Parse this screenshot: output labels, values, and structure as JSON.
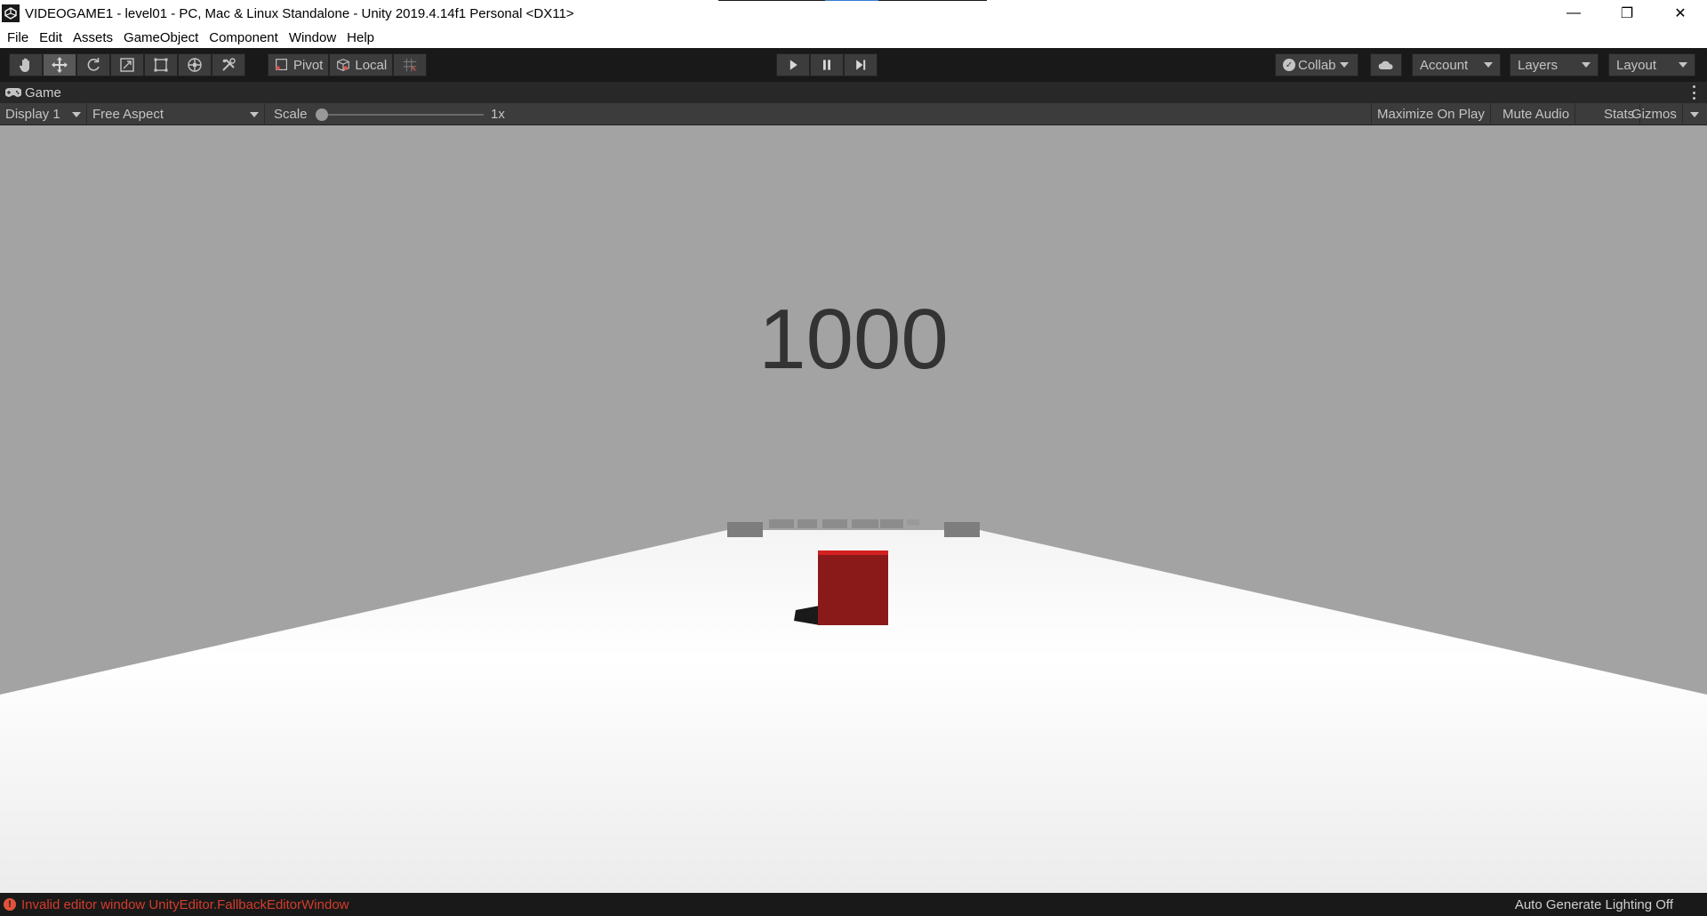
{
  "window": {
    "title": "VIDEOGAME1 - level01 - PC, Mac & Linux Standalone - Unity 2019.4.14f1 Personal <DX11>",
    "minimize_glyph": "—",
    "maximize_glyph": "❐",
    "close_glyph": "✕"
  },
  "menu": {
    "items": [
      "File",
      "Edit",
      "Assets",
      "GameObject",
      "Component",
      "Window",
      "Help"
    ]
  },
  "toolbar": {
    "tools": [
      "hand-tool-icon",
      "move-tool-icon",
      "rotate-tool-icon",
      "scale-tool-icon",
      "rect-tool-icon",
      "transform-tool-icon",
      "custom-tool-icon"
    ],
    "active_tool": "move-tool-icon",
    "pivot_label": "Pivot",
    "local_label": "Local",
    "collab_label": "Collab",
    "account_label": "Account",
    "layers_label": "Layers",
    "layout_label": "Layout"
  },
  "game_tab": {
    "label": "Game"
  },
  "game_bar": {
    "display": "Display 1",
    "aspect": "Free Aspect",
    "scale_label": "Scale",
    "scale_value": "1x",
    "maximize_on_play": "Maximize On Play",
    "mute_audio": "Mute Audio",
    "stats": "Stats",
    "gizmos": "Gizmos"
  },
  "game_view": {
    "score": "1000",
    "sky_color": "#a3a3a3",
    "ground_color": "#ffffff",
    "player_color": "#8a1a1a"
  },
  "status": {
    "error_message": "Invalid editor window UnityEditor.FallbackEditorWindow",
    "right_text": "Auto Generate Lighting Off",
    "error_color": "#d43c2c"
  }
}
